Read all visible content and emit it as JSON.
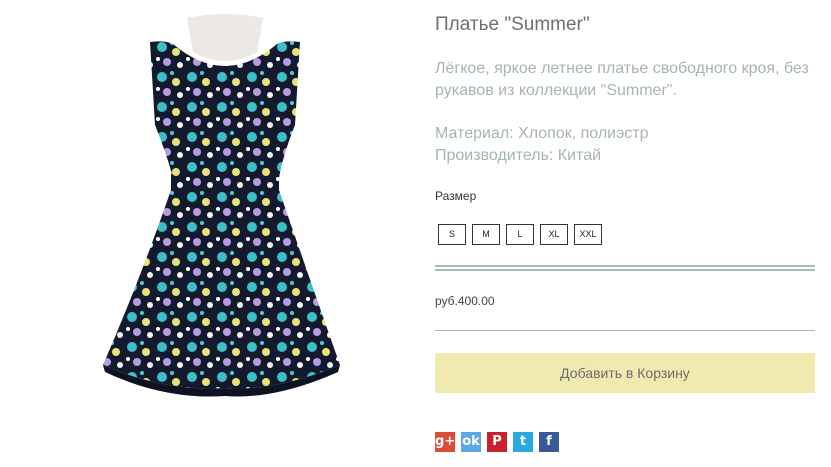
{
  "product": {
    "title": "Платье \"Summer\"",
    "description": "Лёгкое, яркое летнее платье свободного кроя, без рукавов из коллекции \"Summer\".",
    "material": "Материал: Хлопок, полиэстр",
    "manufacturer": "Производитель: Китай",
    "size_label": "Размер",
    "sizes": [
      "S",
      "M",
      "L",
      "XL",
      "XXL"
    ],
    "price": "руб.400.00",
    "add_to_cart": "Добавить в Корзину"
  },
  "social": [
    {
      "name": "google-plus-icon",
      "glyph": "g+",
      "color": "#dd4b39"
    },
    {
      "name": "odnoklassniki-icon",
      "glyph": "ok",
      "color": "#5aa9e6"
    },
    {
      "name": "pinterest-icon",
      "glyph": "P",
      "color": "#c8232c"
    },
    {
      "name": "twitter-icon",
      "glyph": "t",
      "color": "#29a9e1"
    },
    {
      "name": "facebook-icon",
      "glyph": "f",
      "color": "#3b5998"
    }
  ]
}
